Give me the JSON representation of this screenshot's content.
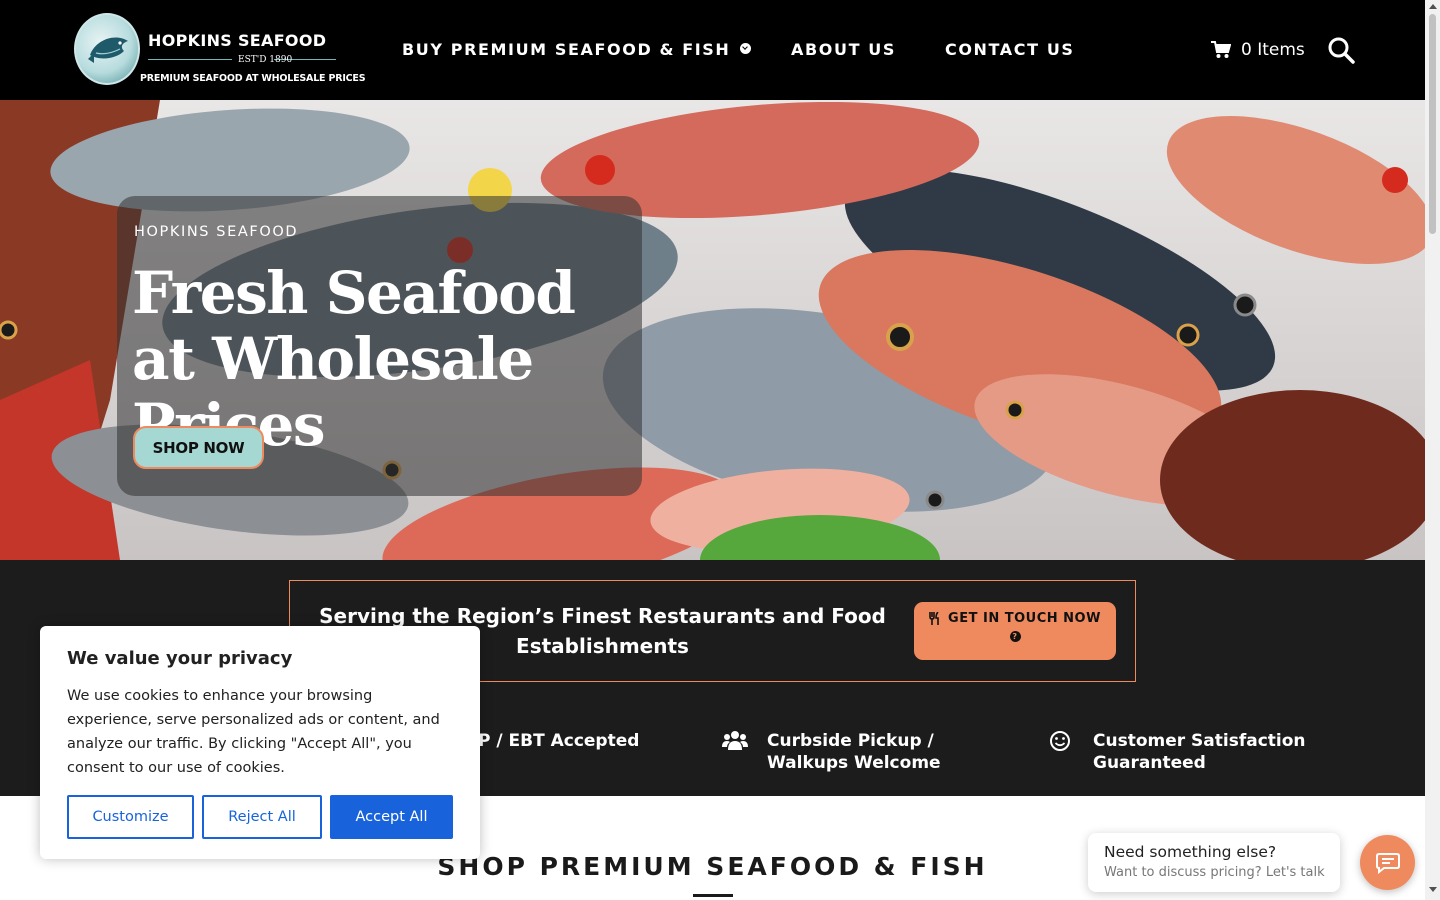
{
  "brand": {
    "name": "HOPKINS SEAFOOD",
    "est": "EST'D 1890",
    "tagline": "PREMIUM SEAFOOD AT WHOLESALE PRICES"
  },
  "nav": {
    "shop": "BUY PREMIUM SEAFOOD & FISH",
    "about": "ABOUT US",
    "contact": "CONTACT US"
  },
  "cart": {
    "label": "0 Items"
  },
  "hero": {
    "kicker": "HOPKINS SEAFOOD",
    "title": "Fresh Seafood at Wholesale Prices",
    "button": "SHOP NOW"
  },
  "cta": {
    "text": "Serving the Region’s Finest Restaurants and Food Establishments",
    "button": "GET IN TOUCH NOW"
  },
  "features": {
    "snap": "P / EBT Accepted",
    "curbside": "Curbside Pickup / Walkups Welcome",
    "satisfaction": "Customer Satisfaction Guaranteed"
  },
  "shop_section": {
    "heading": "SHOP PREMIUM SEAFOOD & FISH"
  },
  "cookie": {
    "title": "We value your privacy",
    "text": "We use cookies to enhance your browsing experience, serve personalized ads or content, and analyze our traffic. By clicking \"Accept All\", you consent to our use of cookies.",
    "customize": "Customize",
    "reject": "Reject All",
    "accept": "Accept All"
  },
  "chat": {
    "line1": "Need something else?",
    "line2": "Want to discuss pricing? Let's talk"
  },
  "colors": {
    "accent": "#ef8a5e",
    "mint": "#a5d7d3",
    "cookie_blue": "#1863dc",
    "band": "#1c1c1c"
  },
  "icons": {
    "cart": "shopping-cart-icon",
    "search": "search-icon",
    "dropdown": "chevron-down-icon",
    "utensils": "utensils-icon",
    "question": "question-circle-icon",
    "users": "users-icon",
    "smile": "smile-icon",
    "chat": "chat-icon"
  }
}
